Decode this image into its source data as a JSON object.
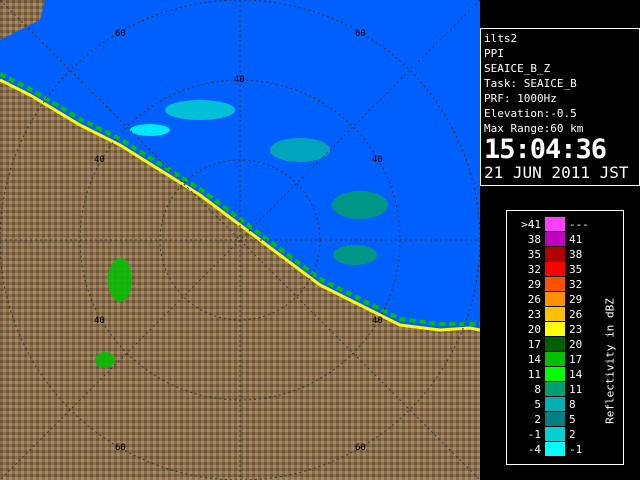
{
  "info": {
    "radar_name": "ilts2",
    "product": "PPI",
    "product_name": "SEAICE_B_Z",
    "task": "Task: SEAICE_B",
    "prf": "PRF: 1000Hz",
    "elevation": "Elevation:-0.5",
    "max_range": "Max Range:60 km",
    "time": "15:04:36",
    "date": "21 JUN 2011 JST"
  },
  "range_labels": [
    "60",
    "40",
    "40",
    "40",
    "40",
    "40",
    "60",
    "60",
    "60"
  ],
  "legend": {
    "unit_label": "Reflectivity in dBZ",
    "rows": [
      {
        "lo": ">41",
        "hi": "---",
        "color": "#ff40ff"
      },
      {
        "lo": "38",
        "hi": "41",
        "color": "#c000c0"
      },
      {
        "lo": "35",
        "hi": "38",
        "color": "#b00000"
      },
      {
        "lo": "32",
        "hi": "35",
        "color": "#ff0000"
      },
      {
        "lo": "29",
        "hi": "32",
        "color": "#ff5000"
      },
      {
        "lo": "26",
        "hi": "29",
        "color": "#ff9000"
      },
      {
        "lo": "23",
        "hi": "26",
        "color": "#ffc000"
      },
      {
        "lo": "20",
        "hi": "23",
        "color": "#ffff00"
      },
      {
        "lo": "17",
        "hi": "20",
        "color": "#006000"
      },
      {
        "lo": "14",
        "hi": "17",
        "color": "#00c000"
      },
      {
        "lo": "11",
        "hi": "14",
        "color": "#00ff00"
      },
      {
        "lo": "8",
        "hi": "11",
        "color": "#00a070"
      },
      {
        "lo": "5",
        "hi": "8",
        "color": "#00b0b0"
      },
      {
        "lo": "2",
        "hi": "5",
        "color": "#008080"
      },
      {
        "lo": "-1",
        "hi": "2",
        "color": "#00d0d0"
      },
      {
        "lo": "-4",
        "hi": "-1",
        "color": "#00ffff"
      }
    ]
  },
  "colors": {
    "sea": "#0060ff",
    "land": "#8a7050",
    "grid": "#333333",
    "coast_band": "#ffff00"
  }
}
